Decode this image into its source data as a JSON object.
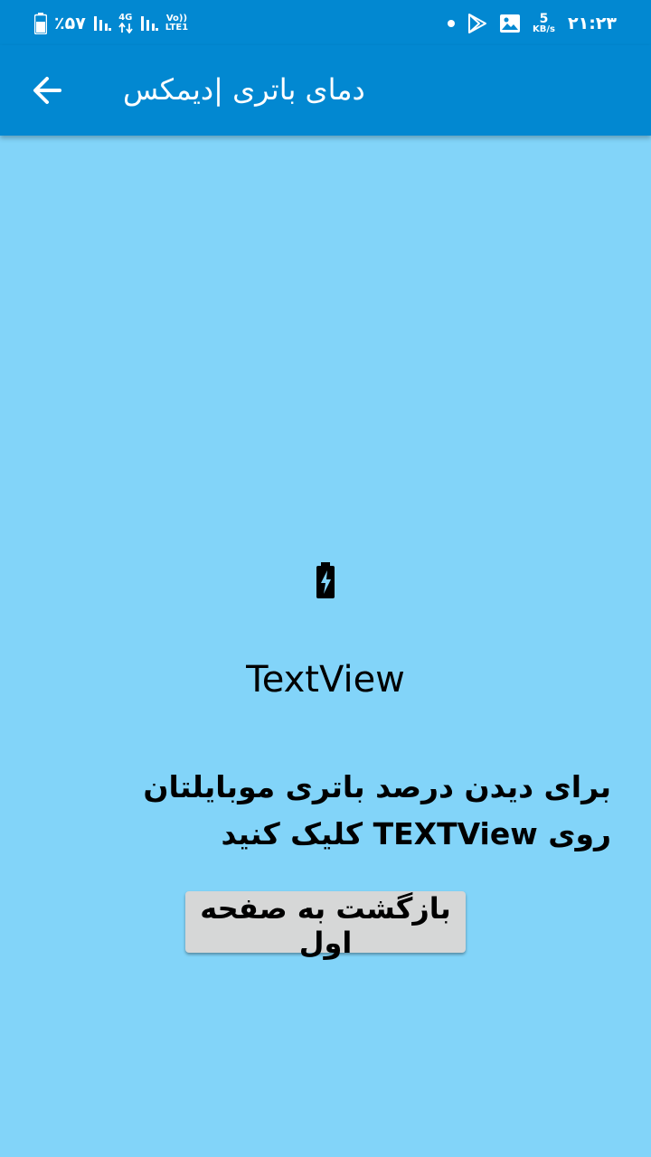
{
  "status_bar": {
    "battery_percent": "٪۵۷",
    "network_type": "4G",
    "volte_label": "Vo))",
    "lte_label": "LTE1",
    "speed_value": "5",
    "speed_unit": "KB/s",
    "time": "۲۱:۲۳"
  },
  "app_bar": {
    "title": "دمای باتری |دیمکس"
  },
  "main": {
    "textview_label": "TextView",
    "instruction": "برای دیدن درصد باتری موبایلتان روی TEXTView کلیک کنید",
    "back_button_label": "بازگشت به صفحه اول"
  },
  "colors": {
    "primary": "#0288d1",
    "background": "#82d4f9",
    "button": "#d6d7d7"
  }
}
